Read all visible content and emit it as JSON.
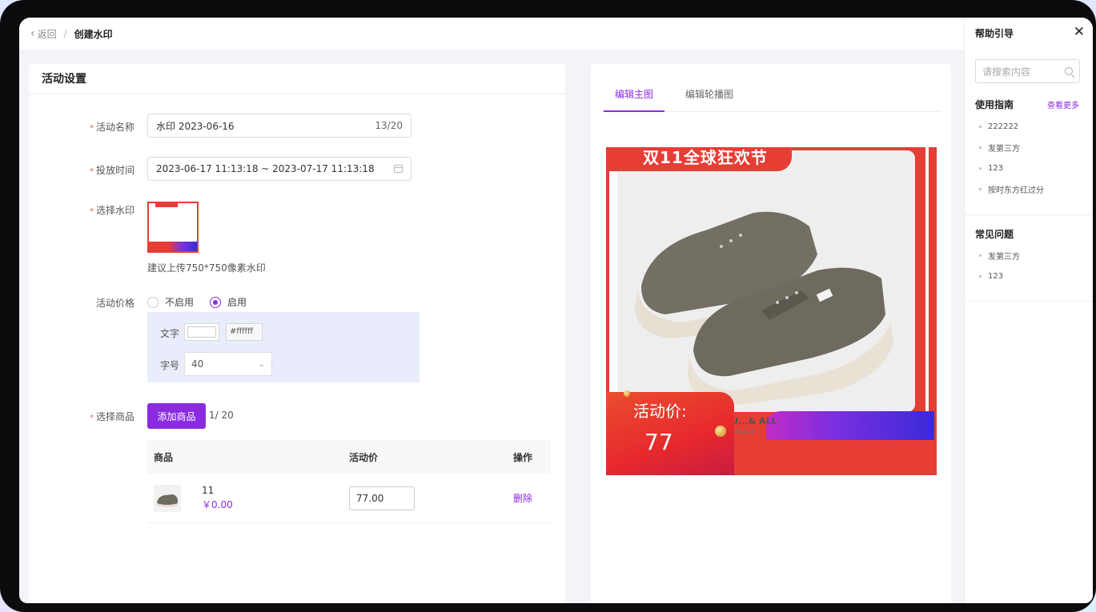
{
  "topbar": {
    "back": "返回",
    "separator": "/",
    "title": "创建水印"
  },
  "settings": {
    "card_title": "活动设置",
    "name_label": "活动名称",
    "name_value": "水印 2023-06-16",
    "name_count": "13/20",
    "time_label": "投放时间",
    "time_value": "2023-06-17 11:13:18 ~ 2023-07-17 11:13:18",
    "watermark_label": "选择水印",
    "watermark_hint": "建议上传750*750像素水印",
    "price_label": "活动价格",
    "radio_off": "不启用",
    "radio_on": "启用",
    "selected_radio": "启用",
    "text_label": "文字",
    "text_color": "#ffffff",
    "size_label": "字号",
    "size_value": "40",
    "goods_label": "选择商品",
    "add_goods": "添加商品",
    "goods_count": "1/ 20",
    "table": {
      "headers": [
        "商品",
        "活动价",
        "操作"
      ],
      "rows": [
        {
          "name": "11",
          "price": "￥0.00",
          "activity_price": "77.00",
          "action": "删除"
        }
      ]
    }
  },
  "preview": {
    "tabs": [
      "编辑主图",
      "编辑轮播图"
    ],
    "active_tab": "编辑主图",
    "banner_text": "双11全球狂欢节",
    "price_label": "活动价:",
    "price_value": "77",
    "brand_text": "IWU...& ALL",
    "brand_sub": "ESIGNED&20"
  },
  "help": {
    "title": "帮助引导",
    "search_placeholder": "请搜索内容",
    "guide_title": "使用指南",
    "more": "查看更多",
    "guide_items": [
      "222222",
      "发第三方",
      "123",
      "按时东方红过分"
    ],
    "faq_title": "常见问题",
    "faq_items": [
      "发第三方",
      "123"
    ]
  },
  "colors": {
    "accent": "#8a2be2",
    "banner_red": "#e63d35",
    "required": "#f25a5a"
  }
}
